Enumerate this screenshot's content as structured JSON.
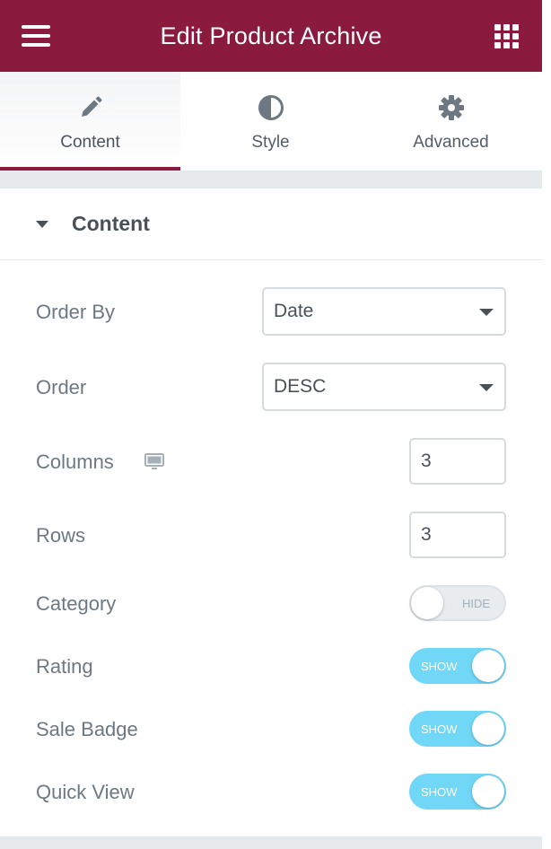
{
  "header": {
    "title": "Edit Product Archive",
    "menu_icon": "hamburger-icon",
    "apps_icon": "grid-icon",
    "brand_color": "#8b1a3f"
  },
  "tabs": [
    {
      "label": "Content",
      "icon": "pencil-icon",
      "active": true
    },
    {
      "label": "Style",
      "icon": "half-circle-icon",
      "active": false
    },
    {
      "label": "Advanced",
      "icon": "gear-icon",
      "active": false
    }
  ],
  "section": {
    "title": "Content",
    "fields": {
      "order_by": {
        "label": "Order By",
        "value": "Date"
      },
      "order": {
        "label": "Order",
        "value": "DESC"
      },
      "columns": {
        "label": "Columns",
        "value": "3",
        "icon": "desktop-icon"
      },
      "rows": {
        "label": "Rows",
        "value": "3"
      },
      "category": {
        "label": "Category",
        "toggle_text": "HIDE",
        "on": false
      },
      "rating": {
        "label": "Rating",
        "toggle_text": "SHOW",
        "on": true
      },
      "sale_badge": {
        "label": "Sale Badge",
        "toggle_text": "SHOW",
        "on": true
      },
      "quick_view": {
        "label": "Quick View",
        "toggle_text": "SHOW",
        "on": true
      }
    }
  },
  "colors": {
    "toggle_on": "#71d7f7",
    "toggle_off": "#e9ecef"
  }
}
